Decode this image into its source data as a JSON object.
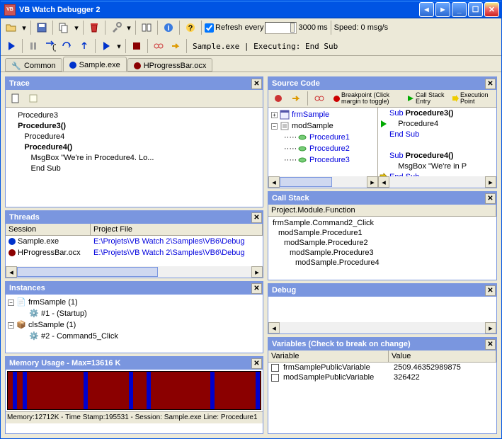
{
  "window": {
    "title": "VB Watch Debugger 2"
  },
  "toolbar1": {
    "refresh_label": "Refresh every",
    "interval_ms": "3000",
    "interval_unit": "ms",
    "checked": true,
    "speed_label": "Speed: 0 msg/s"
  },
  "toolbar2": {
    "status": "Sample.exe | Executing: End Sub"
  },
  "tabs": [
    {
      "label": "Common",
      "icon": "tools"
    },
    {
      "label": "Sample.exe",
      "dot": "#0033cc",
      "active": true
    },
    {
      "label": "HProgressBar.ocx",
      "dot": "#8b0000"
    }
  ],
  "trace": {
    "title": "Trace",
    "lines": [
      {
        "text": "   Procedure3"
      },
      {
        "text": "   Procedure3()",
        "bold": true
      },
      {
        "text": "      Procedure4"
      },
      {
        "text": "      Procedure4()",
        "bold": true
      },
      {
        "text": "         MsgBox \"We're in Procedure4. Lo..."
      },
      {
        "text": "         End Sub"
      }
    ]
  },
  "threads": {
    "title": "Threads",
    "cols": [
      "Session",
      "Project File"
    ],
    "rows": [
      {
        "dot": "#0033cc",
        "session": "Sample.exe",
        "path": "E:\\Projets\\VB Watch 2\\Samples\\VB6\\Debug"
      },
      {
        "dot": "#8b0000",
        "session": "HProgressBar.ocx",
        "path": "E:\\Projets\\VB Watch 2\\Samples\\VB6\\Debug"
      }
    ]
  },
  "instances": {
    "title": "Instances",
    "tree": [
      {
        "lvl": 0,
        "icon": "form",
        "label": "frmSample (1)"
      },
      {
        "lvl": 1,
        "icon": "gear",
        "label": "#1 - (Startup)"
      },
      {
        "lvl": 0,
        "icon": "class",
        "label": "clsSample (1)"
      },
      {
        "lvl": 1,
        "icon": "gear",
        "label": "#2 - Command5_Click"
      }
    ]
  },
  "memory": {
    "title": "Memory Usage - Max=13616 K",
    "status": "Memory:12712K - Time Stamp:195531 - Session: Sample.exe\nLine: Procedure1",
    "bars_pct": [
      2,
      6,
      30,
      48,
      55,
      80,
      98
    ]
  },
  "source": {
    "title": "Source Code",
    "legend": {
      "bp": "Breakpoint (Click margin to toggle)",
      "cs": "Call Stack Entry",
      "ep": "Execution Point"
    },
    "tree": [
      {
        "lvl": 0,
        "expand": "+",
        "icon": "form-b",
        "label": "frmSample",
        "link": true
      },
      {
        "lvl": 0,
        "expand": "-",
        "icon": "module",
        "label": "modSample",
        "link": false
      },
      {
        "lvl": 1,
        "icon": "proc",
        "label": "Procedure1",
        "link": true
      },
      {
        "lvl": 1,
        "icon": "proc",
        "label": "Procedure2",
        "link": true
      },
      {
        "lvl": 1,
        "icon": "proc",
        "label": "Procedure3",
        "link": true
      }
    ],
    "code": [
      {
        "gut": "",
        "html": "<span class='kw'>Sub</span> <span class='b'>Procedure3()</span>"
      },
      {
        "gut": "run",
        "html": "    Procedure4"
      },
      {
        "gut": "",
        "html": "<span class='kw'>End Sub</span>"
      },
      {
        "gut": "",
        "html": ""
      },
      {
        "gut": "",
        "html": "<span class='kw'>Sub</span> <span class='b'>Procedure4()</span>"
      },
      {
        "gut": "",
        "html": "    MsgBox <span class='str'>\"We're in P</span>"
      },
      {
        "gut": "exec",
        "html": "<span class='kw'>End Sub</span>"
      }
    ]
  },
  "callstack": {
    "title": "Call Stack",
    "header": "Project.Module.Function",
    "rows": [
      "frmSample.Command2_Click",
      "modSample.Procedure1",
      "modSample.Procedure2",
      "modSample.Procedure3",
      "modSample.Procedure4"
    ]
  },
  "debug": {
    "title": "Debug"
  },
  "variables": {
    "title": "Variables (Check to break on change)",
    "cols": [
      "Variable",
      "Value"
    ],
    "rows": [
      {
        "name": "frmSamplePublicVariable",
        "value": "2509.46352989875"
      },
      {
        "name": "modSamplePublicVariable",
        "value": "326422"
      }
    ]
  }
}
